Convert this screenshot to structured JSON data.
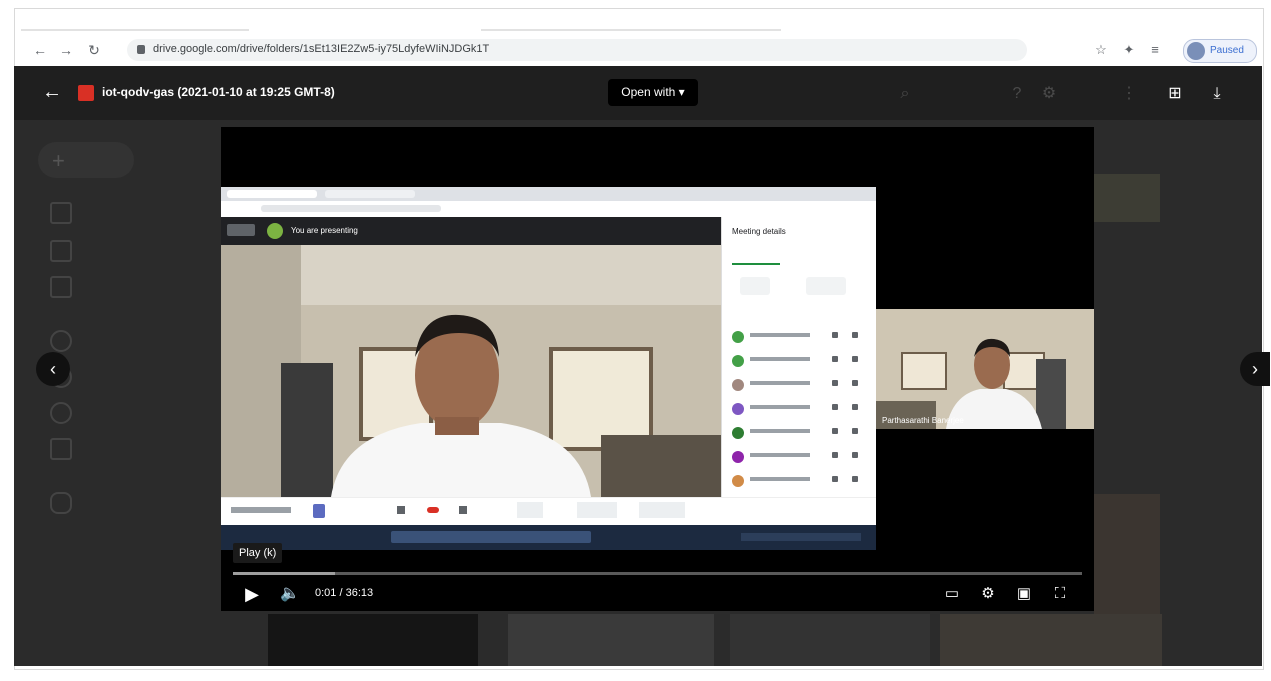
{
  "browser": {
    "url": "drive.google.com/drive/folders/1sEt13IE2Zw5-iy75LdyfeWIiNJDGk1T",
    "profile_label": "Paused",
    "icons": [
      "back-icon",
      "forward-icon",
      "reload-icon",
      "lock-icon",
      "star-icon",
      "extension-icon",
      "reading-list-icon"
    ]
  },
  "viewer": {
    "file_title": "iot-qodv-gas (2021-01-10 at 19:25 GMT-8)",
    "open_with_label": "Open with ▾",
    "icons": [
      "back-arrow-icon",
      "add-comment-icon",
      "download-icon"
    ]
  },
  "player": {
    "tooltip": "Play (k)",
    "time_display": "0:01 / 36:13",
    "progress_fraction": 0.12,
    "icons": [
      "play-icon",
      "volume-icon",
      "captions-icon",
      "settings-icon",
      "miniplayer-icon",
      "fullscreen-icon"
    ]
  },
  "meet": {
    "presenting_text": "You are presenting",
    "panel_title": "Meeting details",
    "participant_count": 7,
    "camera_name": "Parthasarathi Banerjee"
  },
  "colors": {
    "page_bg": "#2b2b2b",
    "viewer_bar": "#1f1f1f",
    "file_icon": "#d93025",
    "profile_text": "#3c6fd1"
  }
}
